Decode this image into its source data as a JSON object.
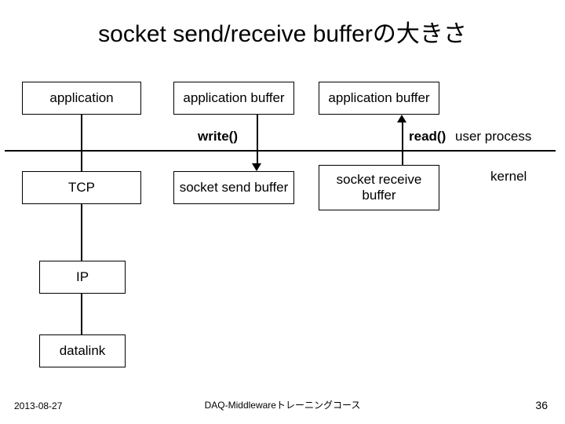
{
  "title": "socket send/receive bufferの大きさ",
  "boxes": {
    "application": "application",
    "app_buffer_send": "application buffer",
    "app_buffer_recv": "application buffer",
    "tcp": "TCP",
    "send_buffer": "socket send buffer",
    "recv_buffer": "socket receive buffer",
    "ip": "IP",
    "datalink": "datalink"
  },
  "labels": {
    "write": "write()",
    "read": "read()",
    "user_process": "user process",
    "kernel": "kernel"
  },
  "footer": {
    "date": "2013-08-27",
    "center": "DAQ-Middlewareトレーニングコース",
    "page": "36"
  }
}
